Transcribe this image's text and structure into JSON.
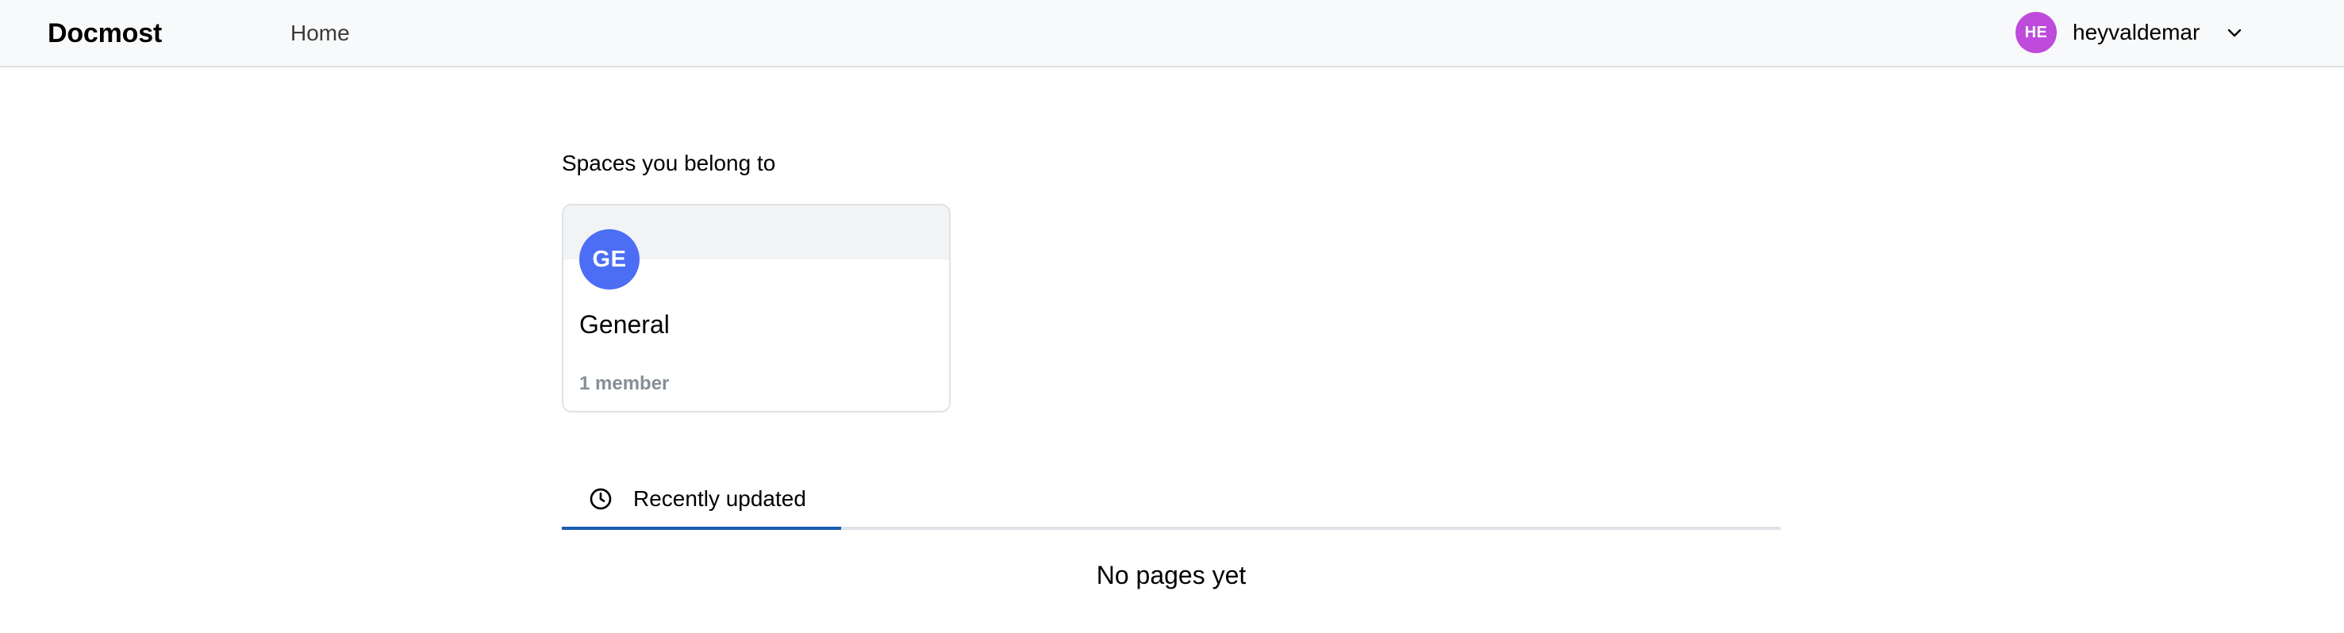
{
  "header": {
    "brand": "Docmost",
    "nav": {
      "home_label": "Home"
    },
    "user": {
      "initials": "HE",
      "name": "heyvaldemar",
      "avatar_color": "#be4bdb",
      "menu_icon": "chevron-down-icon"
    }
  },
  "main": {
    "spaces_title": "Spaces you belong to",
    "spaces": [
      {
        "initials": "GE",
        "name": "General",
        "members": "1 member",
        "avatar_color": "#4c6ef5"
      }
    ],
    "tabs": [
      {
        "label": "Recently updated",
        "icon": "clock-icon",
        "active": true
      }
    ],
    "empty_message": "No pages yet",
    "accent_color": "#1c5eb0"
  }
}
